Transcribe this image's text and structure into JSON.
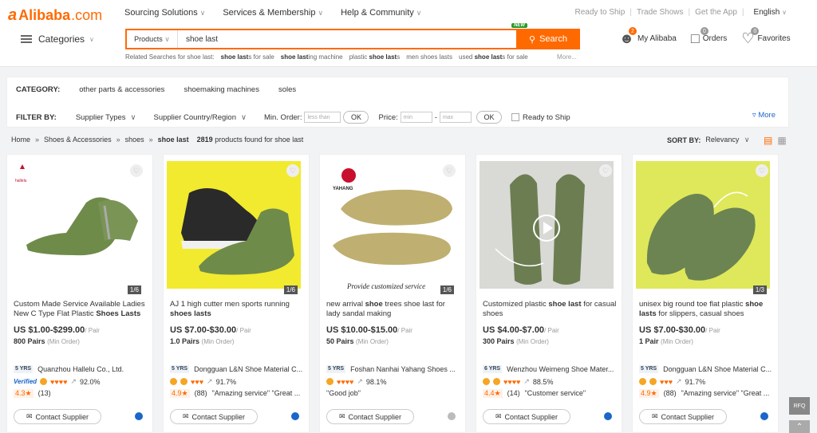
{
  "header": {
    "logo_mark": "a",
    "logo_name": "Alibaba",
    "logo_suffix": ".com",
    "nav": [
      "Sourcing Solutions",
      "Services & Membership",
      "Help & Community"
    ],
    "right_links": [
      "Ready to Ship",
      "Trade Shows",
      "Get the App"
    ],
    "language": "English",
    "categories_label": "Categories"
  },
  "search": {
    "scope": "Products",
    "query": "shoe last",
    "button_label": "Search",
    "new_badge": "NEW",
    "related_label": "Related Searches for shoe last:",
    "related": [
      {
        "pre": "",
        "bold": "shoe last",
        "post": "s for sale"
      },
      {
        "pre": "",
        "bold": "shoe last",
        "post": "ing machine"
      },
      {
        "pre": "plastic ",
        "bold": "shoe last",
        "post": "s"
      },
      {
        "pre": "men shoes lasts",
        "bold": "",
        "post": ""
      },
      {
        "pre": "used ",
        "bold": "shoe last",
        "post": "s for sale"
      }
    ],
    "related_more": "More..."
  },
  "user": {
    "my_alibaba": "My Alibaba",
    "my_alibaba_count": "2",
    "orders": "Orders",
    "orders_count": "0",
    "favorites": "Favorites",
    "favorites_count": "0"
  },
  "filters": {
    "category_label": "CATEGORY:",
    "categories": [
      "other parts & accessories",
      "shoemaking machines",
      "soles"
    ],
    "filter_label": "FILTER BY:",
    "supplier_types": "Supplier Types",
    "supplier_country": "Supplier Country/Region",
    "min_order_label": "Min. Order:",
    "min_order_placeholder": "less than",
    "ok": "OK",
    "price_label": "Price:",
    "price_min": "min",
    "price_max": "max",
    "ready_to_ship": "Ready to Ship",
    "more": "More"
  },
  "breadcrumb": {
    "items": [
      "Home",
      "Shoes & Accessories",
      "shoes",
      "shoe last"
    ],
    "count": "2819",
    "found_text": "products found for",
    "query": "shoe last"
  },
  "sort": {
    "label": "SORT BY:",
    "value": "Relevancy"
  },
  "products": [
    {
      "title_pre": "Custom Made Service Available Ladies New C Type Flat Plastic ",
      "title_bold": "Shoes Lasts",
      "title_post": "",
      "price": "US $1.00-$299.00",
      "unit": "/ Pair",
      "moq": "800 Pairs",
      "moq_note": "(Min Order)",
      "years": "5 YRS",
      "supplier": "Quanzhou Hallelu Co., Ltd.",
      "verified": "Verified",
      "response": "92.0%",
      "score": "4.3",
      "reviews": "(13)",
      "review_quote": "",
      "counter": "1/6",
      "image_logo": "hallelu",
      "chat_online": true
    },
    {
      "title_pre": "AJ 1 high cutter men sports running ",
      "title_bold": "shoes lasts",
      "title_post": "",
      "price": "US $7.00-$30.00",
      "unit": "/ Pair",
      "moq": "1.0 Pairs",
      "moq_note": "(Min Order)",
      "years": "5 YRS",
      "supplier": "Dongguan L&N Shoe Material C...",
      "verified": "",
      "response": "91.7%",
      "score": "4.9",
      "reviews": "(88)",
      "review_quote": "\"Amazing service\"  \"Great ...",
      "counter": "1/6",
      "image_logo": "",
      "chat_online": true
    },
    {
      "title_pre": "new arrival ",
      "title_bold": "shoe",
      "title_post": " trees shoe last for lady sandal making",
      "price": "US $10.00-$15.00",
      "unit": "/ Pair",
      "moq": "50 Pairs",
      "moq_note": "(Min Order)",
      "years": "5 YRS",
      "supplier": "Foshan Nanhai Yahang Shoes ...",
      "verified": "",
      "response": "98.1%",
      "score": "",
      "reviews": "",
      "review_quote": "\"Good job\"",
      "counter": "1/6",
      "image_logo": "YAHANG",
      "image_caption": "Provide customized service",
      "chat_online": false
    },
    {
      "title_pre": "Customized plastic ",
      "title_bold": "shoe last",
      "title_post": " for casual shoes",
      "price": "US $4.00-$7.00",
      "unit": "/ Pair",
      "moq": "300 Pairs",
      "moq_note": "(Min Order)",
      "years": "6 YRS",
      "supplier": "Wenzhou Weimeng Shoe Mater...",
      "verified": "",
      "response": "88.5%",
      "score": "4.4",
      "reviews": "(14)",
      "review_quote": "\"Customer service\"",
      "counter": "",
      "image_logo": "",
      "chat_online": true
    },
    {
      "title_pre": "unisex big round toe flat plastic ",
      "title_bold": "shoe lasts",
      "title_post": " for slippers, casual shoes",
      "price": "US $7.00-$30.00",
      "unit": "/ Pair",
      "moq": "1 Pair",
      "moq_note": "(Min Order)",
      "years": "5 YRS",
      "supplier": "Dongguan L&N Shoe Material C...",
      "verified": "",
      "response": "91.7%",
      "score": "4.9",
      "reviews": "(88)",
      "review_quote": "\"Amazing service\"  \"Great ...",
      "counter": "1/3",
      "image_logo": "",
      "chat_online": true
    }
  ],
  "contact_label": "Contact Supplier",
  "rfq_label": "RFQ",
  "colors": {
    "accent": "#ff6a00",
    "link": "#1a66c9",
    "last_green": "#6f8b4a"
  }
}
